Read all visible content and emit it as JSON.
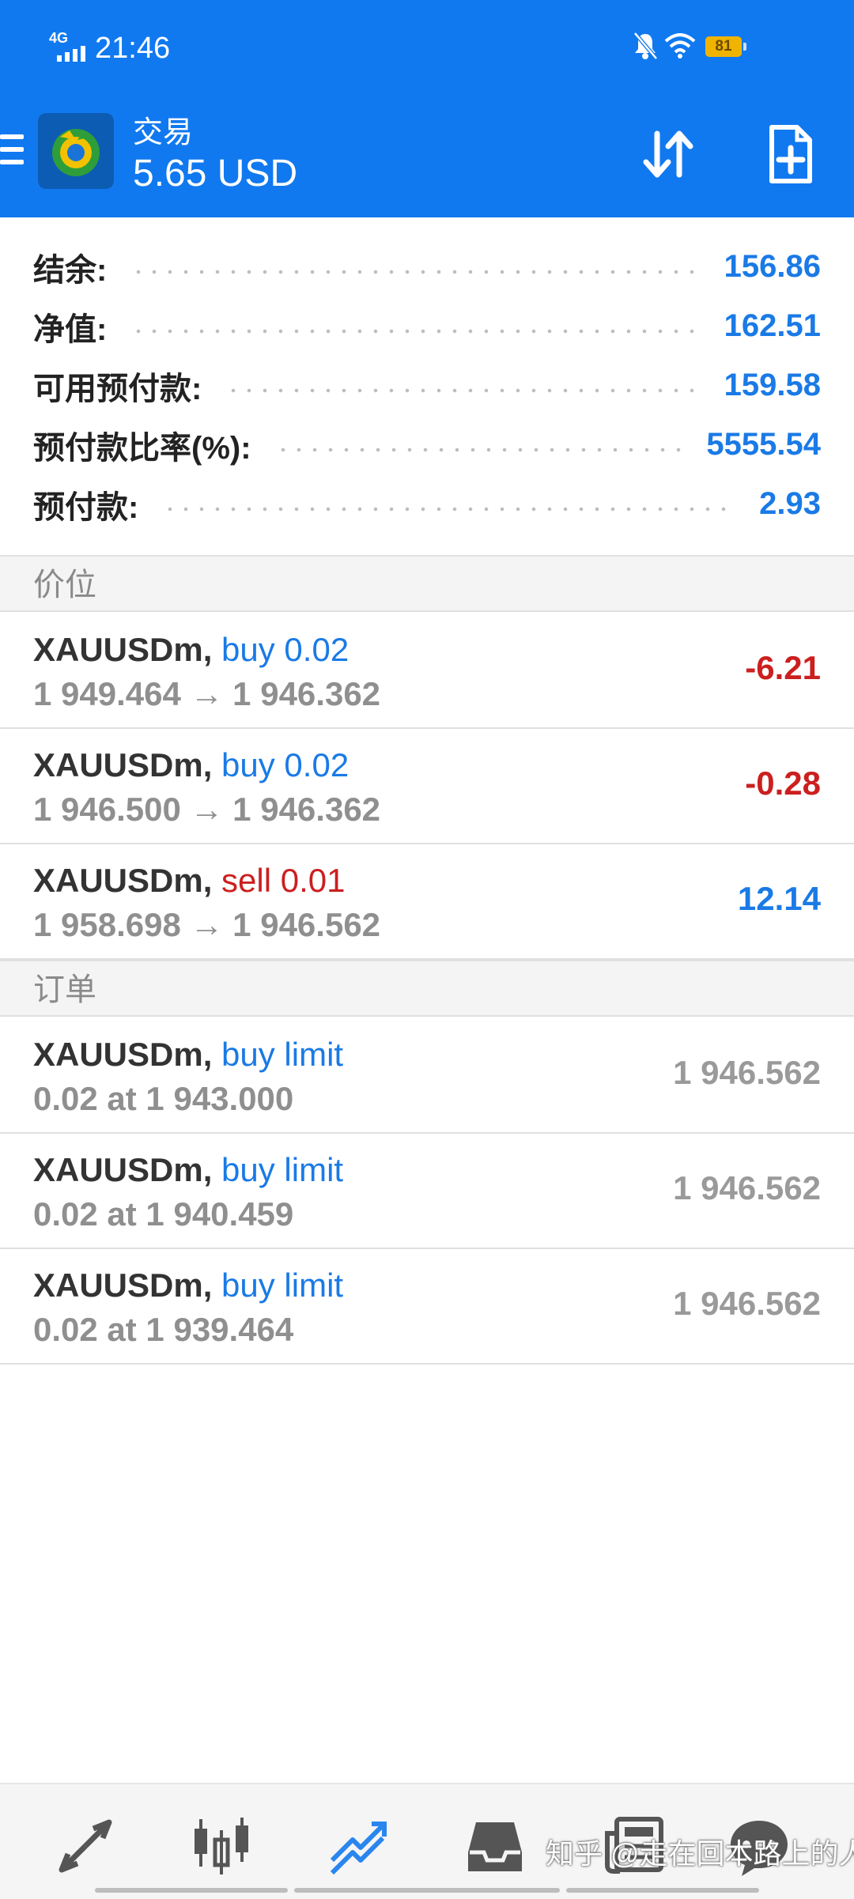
{
  "status_bar": {
    "network": "4G",
    "time": "21:46",
    "battery": "81"
  },
  "header": {
    "title": "交易",
    "balance_display": "5.65 USD"
  },
  "summary": [
    {
      "label": "结余:",
      "value": "156.86"
    },
    {
      "label": "净值:",
      "value": "162.51"
    },
    {
      "label": "可用预付款:",
      "value": "159.58"
    },
    {
      "label": "预付款比率(%):",
      "value": "5555.54"
    },
    {
      "label": "预付款:",
      "value": "2.93"
    }
  ],
  "positions": {
    "header": "价位",
    "items": [
      {
        "symbol": "XAUUSDm,",
        "action": "buy 0.02",
        "type": "buy",
        "prices": "1 949.464 → 1 946.362",
        "profit": "-6.21"
      },
      {
        "symbol": "XAUUSDm,",
        "action": "buy 0.02",
        "type": "buy",
        "prices": "1 946.500 → 1 946.362",
        "profit": "-0.28"
      },
      {
        "symbol": "XAUUSDm,",
        "action": "sell 0.01",
        "type": "sell",
        "prices": "1 958.698 → 1 946.562",
        "profit": "12.14"
      }
    ]
  },
  "orders": {
    "header": "订单",
    "items": [
      {
        "symbol": "XAUUSDm,",
        "action": "buy limit",
        "detail": "0.02 at 1 943.000",
        "price": "1 946.562"
      },
      {
        "symbol": "XAUUSDm,",
        "action": "buy limit",
        "detail": "0.02 at 1 940.459",
        "price": "1 946.562"
      },
      {
        "symbol": "XAUUSDm,",
        "action": "buy limit",
        "detail": "0.02 at 1 939.464",
        "price": "1 946.562"
      }
    ]
  },
  "bottom_nav": {
    "items": [
      "quotes-icon",
      "chart-icon",
      "trade-icon",
      "history-icon",
      "news-icon",
      "chat-icon"
    ],
    "active": "trade-icon"
  },
  "watermark": "知乎 @走在回本路上的人",
  "colors": {
    "primary": "#1179f0",
    "profit": "#1a7ae6",
    "loss": "#cc1f1f"
  }
}
